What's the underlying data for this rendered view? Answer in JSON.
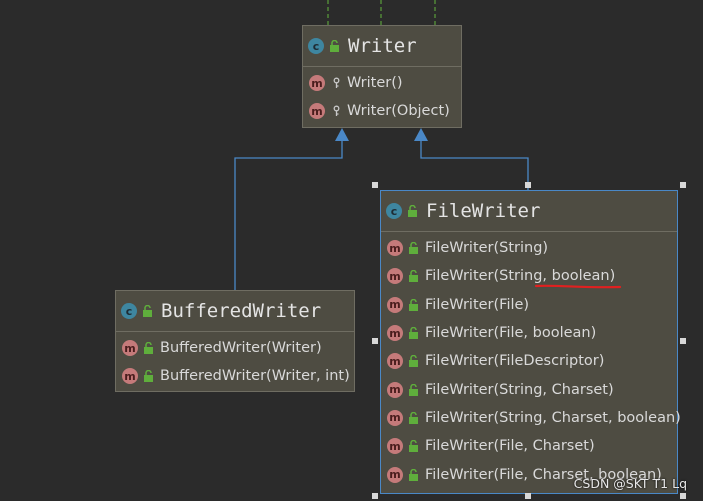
{
  "classes": {
    "writer": {
      "icon": "c",
      "name": "Writer",
      "members": [
        "Writer()",
        "Writer(Object)"
      ]
    },
    "filewriter": {
      "icon": "c",
      "name": "FileWriter",
      "members": [
        "FileWriter(String)",
        "FileWriter(String, boolean)",
        "FileWriter(File)",
        "FileWriter(File, boolean)",
        "FileWriter(FileDescriptor)",
        "FileWriter(String, Charset)",
        "FileWriter(String, Charset, boolean)",
        "FileWriter(File, Charset)",
        "FileWriter(File, Charset, boolean)"
      ]
    },
    "bufferedwriter": {
      "icon": "c",
      "name": "BufferedWriter",
      "members": [
        "BufferedWriter(Writer)",
        "BufferedWriter(Writer, int)"
      ]
    }
  },
  "method_icon": "m",
  "watermark": "CSDN @SKT T1 Lq",
  "colors": {
    "background": "#2b2b2b",
    "box": "#4e4c42",
    "arrow": "#4a88c7",
    "dashed": "#5a9e3a",
    "annotation": "#e02020"
  }
}
